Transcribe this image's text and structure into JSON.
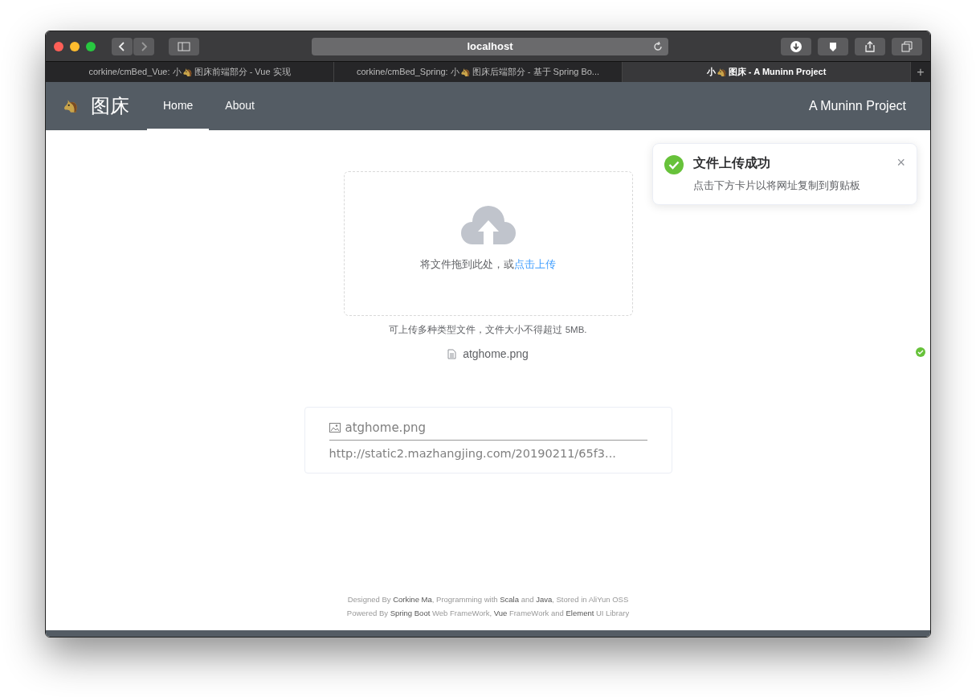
{
  "browser": {
    "address": "localhost",
    "tabs": [
      {
        "before": "corkine/cmBed_Vue: 小",
        "after": "图床前端部分 - Vue 实现",
        "selected": false
      },
      {
        "before": "corkine/cmBed_Spring: 小",
        "after": "图床后端部分 - 基于 Spring Bo...",
        "selected": false
      },
      {
        "before": "小",
        "after": "图床 - A Muninn Project",
        "selected": true
      }
    ],
    "new_tab": "+"
  },
  "navbar": {
    "logo": "图床",
    "items": [
      {
        "label": "Home",
        "selected": true
      },
      {
        "label": "About",
        "selected": false
      }
    ],
    "right": "A Muninn Project"
  },
  "notification": {
    "title": "文件上传成功",
    "message": "点击下方卡片以将网址复制到剪贴板",
    "close": "×"
  },
  "upload": {
    "prompt": "将文件拖到此处，或",
    "link": "点击上传",
    "tip": "可上传多种类型文件，文件大小不得超过 5MB.",
    "files": [
      {
        "name": "atghome.png",
        "uploaded": true
      }
    ]
  },
  "card": {
    "name": "atghome.png",
    "url": "http://static2.mazhangjing.com/20190211/65f3..."
  },
  "footer": [
    "Designed By **Corkine Ma**, Programming with **Scala** and **Java**, Stored in AliYun OSS",
    "Powered By **Spring Boot** Web FrameWork, **Vue** FrameWork and **Element** UI Library"
  ]
}
